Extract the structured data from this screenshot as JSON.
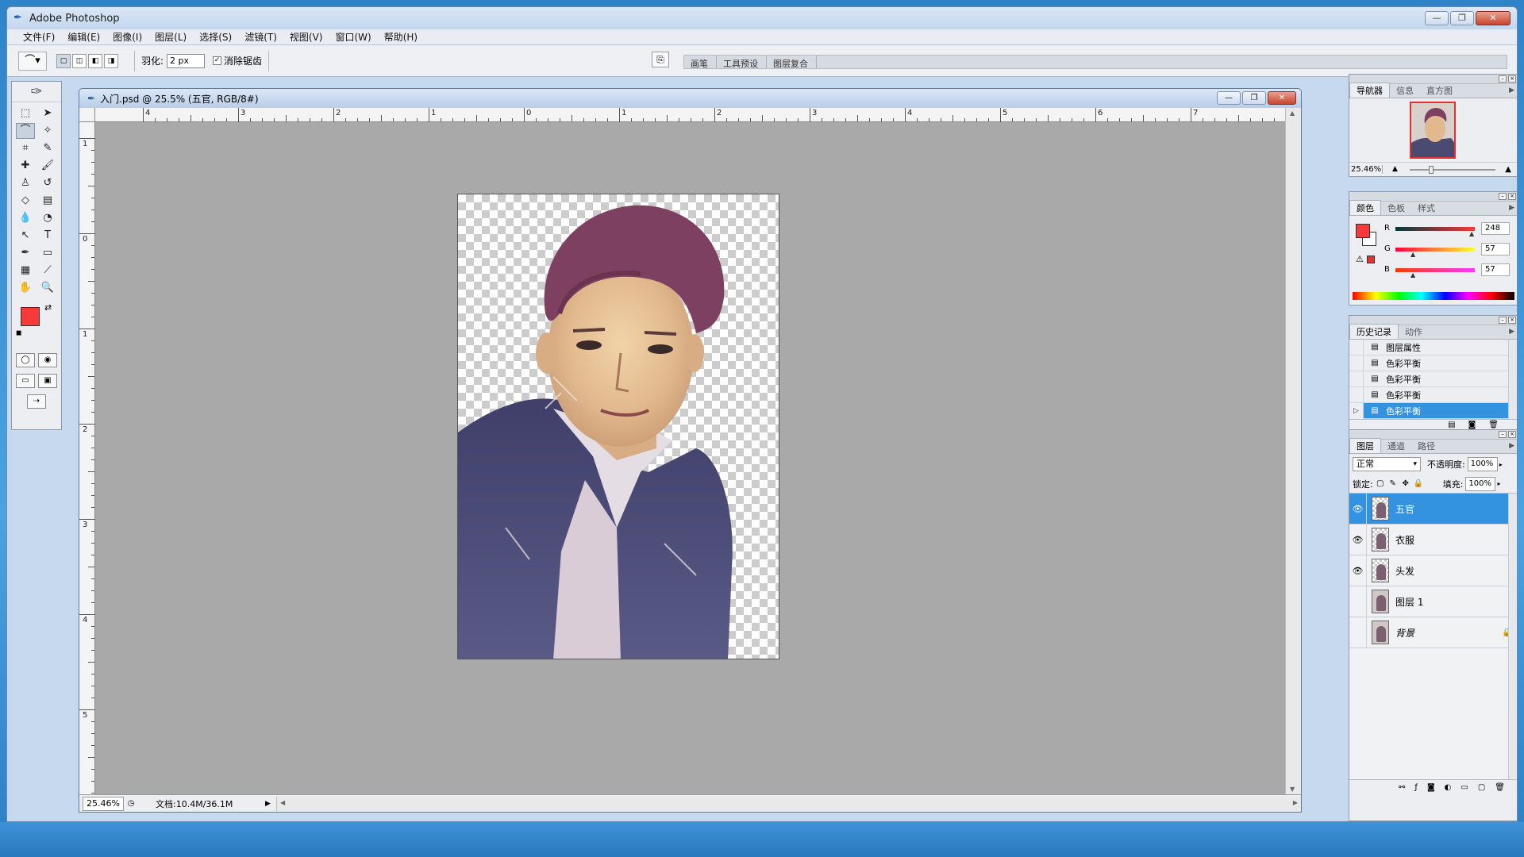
{
  "app": {
    "title": "Adobe Photoshop",
    "window_buttons": [
      "—",
      "❐",
      "✕"
    ]
  },
  "menu": [
    "文件(F)",
    "编辑(E)",
    "图像(I)",
    "图层(L)",
    "选择(S)",
    "滤镜(T)",
    "视图(V)",
    "窗口(W)",
    "帮助(H)"
  ],
  "options": {
    "feather_label": "羽化:",
    "feather_value": "2 px",
    "antialias_label": "消除锯齿",
    "antialias_checked": true,
    "palette_well_tabs": [
      "画笔",
      "工具预设",
      "图层复合"
    ]
  },
  "document": {
    "title": "入门.psd @ 25.5% (五官, RGB/8#)",
    "zoom": "25.46%",
    "doc_size": "文档:10.4M/36.1M",
    "ruler_top_labels": [
      "4",
      "3",
      "2",
      "1",
      "0",
      "1",
      "2",
      "3",
      "4",
      "5",
      "6",
      "7"
    ],
    "ruler_left_labels": [
      "1",
      "0",
      "1",
      "2",
      "3",
      "4",
      "5"
    ]
  },
  "navigator": {
    "tabs": [
      "导航器",
      "信息",
      "直方图"
    ],
    "zoom": "25.46%"
  },
  "color": {
    "tabs": [
      "颜色",
      "色板",
      "样式"
    ],
    "r_label": "R",
    "g_label": "G",
    "b_label": "B",
    "r": "248",
    "g": "57",
    "b": "57",
    "fg_color": "#f83939"
  },
  "history": {
    "tabs": [
      "历史记录",
      "动作"
    ],
    "items": [
      "图层属性",
      "色彩平衡",
      "色彩平衡",
      "色彩平衡",
      "色彩平衡"
    ],
    "selected_index": 4
  },
  "layers": {
    "tabs": [
      "图层",
      "通道",
      "路径"
    ],
    "blend_mode": "正常",
    "opacity_label": "不透明度:",
    "opacity": "100%",
    "lock_label": "锁定:",
    "fill_label": "填充:",
    "fill": "100%",
    "items": [
      {
        "name": "五官",
        "visible": true,
        "selected": true
      },
      {
        "name": "衣服",
        "visible": true,
        "selected": false
      },
      {
        "name": "头发",
        "visible": true,
        "selected": false
      },
      {
        "name": "图层 1",
        "visible": false,
        "selected": false
      },
      {
        "name": "背景",
        "visible": false,
        "selected": false,
        "locked": true
      }
    ]
  },
  "colors": {
    "selection_blue": "#3393e0",
    "foreground_red": "#f83939"
  }
}
